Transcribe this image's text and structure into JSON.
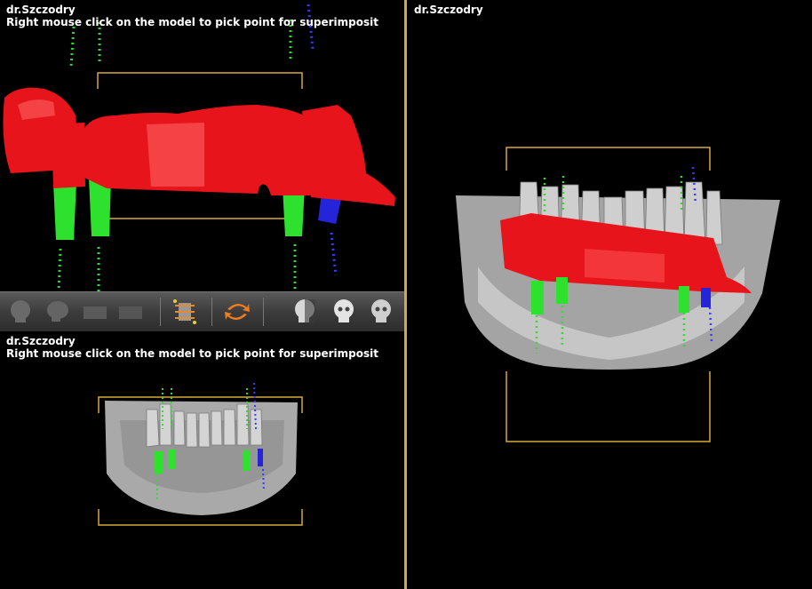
{
  "views": {
    "top_left": {
      "title": "dr.Szczodry",
      "hint": "Right mouse click on the model to pick point for superimposit"
    },
    "bottom_left": {
      "title": "dr.Szczodry",
      "hint": "Right mouse click on the model to pick point for superimposit"
    },
    "right": {
      "title": "dr.Szczodry"
    }
  },
  "toolbar": {
    "tools": [
      {
        "icon": "skull-front-dim-icon"
      },
      {
        "icon": "skull-side-dim-icon"
      },
      {
        "icon": "texture-dim-icon"
      },
      {
        "icon": "texture-dim-2-icon"
      },
      {
        "icon": "slice-stack-icon"
      },
      {
        "icon": "rotate-arrows-icon"
      },
      {
        "icon": "skull-side-icon"
      },
      {
        "icon": "skull-front-icon"
      },
      {
        "icon": "skull-front-2-icon"
      }
    ]
  },
  "colors": {
    "frame": "#d7a93a",
    "bridge": "#e8141b",
    "implant": "#2ee12e",
    "implant_blue": "#2424d8",
    "bone": "#b8b8b8"
  }
}
